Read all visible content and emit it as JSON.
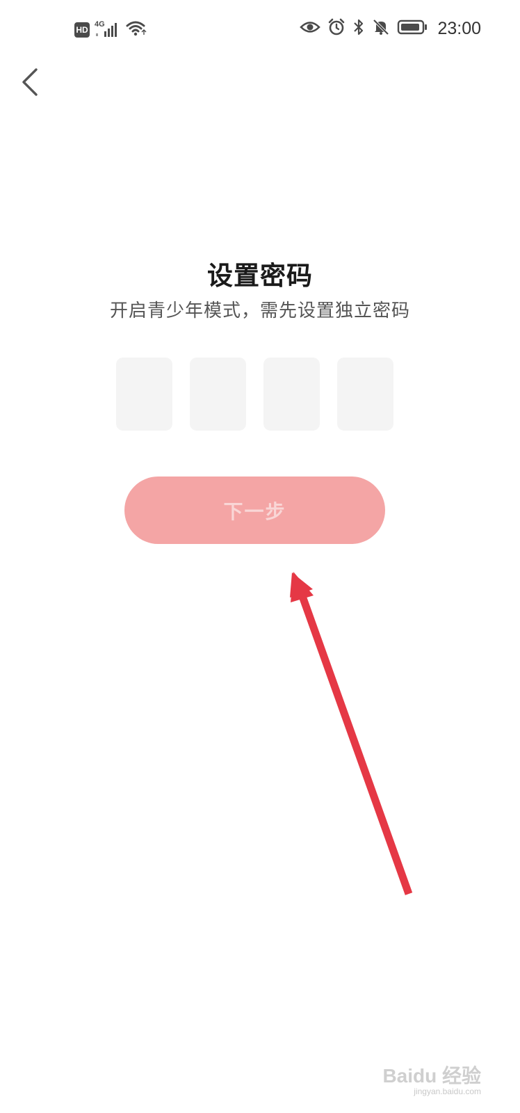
{
  "status_bar": {
    "hd_badge": "HD",
    "network_type": "4G",
    "time": "23:00",
    "icons": [
      "hd-icon",
      "signal-icon",
      "wifi-icon",
      "eye-icon",
      "alarm-icon",
      "bluetooth-icon",
      "mute-icon",
      "battery-icon"
    ]
  },
  "nav": {
    "back_icon": "chevron-left-icon"
  },
  "main": {
    "title": "设置密码",
    "subtitle": "开启青少年模式，需先设置独立密码",
    "pin_boxes": [
      "",
      "",
      "",
      ""
    ],
    "next_label": "下一步"
  },
  "watermark": {
    "brand": "Baidu 经验",
    "domain": "jingyan.baidu.com"
  },
  "colors": {
    "button_bg": "#f4a5a5",
    "button_text": "#f9d6d6",
    "pin_box_bg": "#f4f4f4",
    "arrow": "#e53845"
  }
}
